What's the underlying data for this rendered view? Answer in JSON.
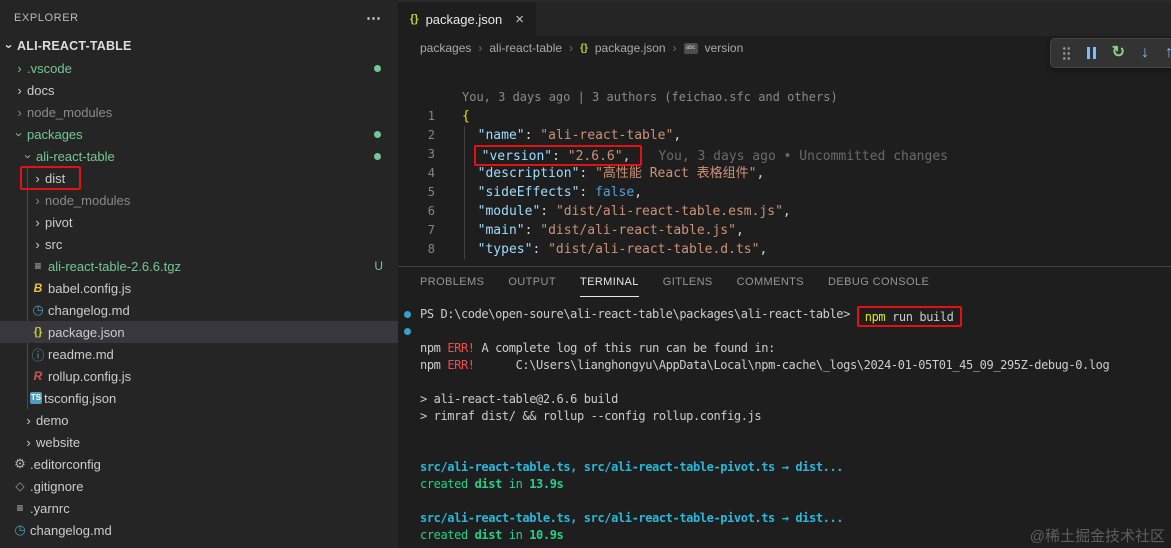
{
  "sidebar": {
    "header": "EXPLORER",
    "more_label": "⋯",
    "root": "ALI-REACT-TABLE",
    "items": [
      {
        "label": ".vscode",
        "kind": "folder",
        "indent": 1,
        "color": "green",
        "badge": "dot"
      },
      {
        "label": "docs",
        "kind": "folder",
        "indent": 1
      },
      {
        "label": "node_modules",
        "kind": "folder",
        "indent": 1,
        "color": "dim"
      },
      {
        "label": "packages",
        "kind": "folder",
        "indent": 1,
        "color": "green",
        "badge": "dot",
        "open": true
      },
      {
        "label": "ali-react-table",
        "kind": "folder",
        "indent": 2,
        "color": "green",
        "badge": "dot",
        "open": true
      },
      {
        "label": "dist",
        "kind": "folder",
        "indent": 3,
        "redbox": true
      },
      {
        "label": "node_modules",
        "kind": "folder",
        "indent": 3,
        "color": "dim"
      },
      {
        "label": "pivot",
        "kind": "folder",
        "indent": 3
      },
      {
        "label": "src",
        "kind": "folder",
        "indent": 3
      },
      {
        "label": "ali-react-table-2.6.6.tgz",
        "kind": "file",
        "icon": "lines",
        "indent": 3,
        "color": "green",
        "badge": "U"
      },
      {
        "label": "babel.config.js",
        "kind": "file",
        "icon": "babel",
        "indent": 3
      },
      {
        "label": "changelog.md",
        "kind": "file",
        "icon": "clock",
        "indent": 3
      },
      {
        "label": "package.json",
        "kind": "file",
        "icon": "braces",
        "indent": 3,
        "selected": true
      },
      {
        "label": "readme.md",
        "kind": "file",
        "icon": "info",
        "indent": 3
      },
      {
        "label": "rollup.config.js",
        "kind": "file",
        "icon": "rollup",
        "indent": 3
      },
      {
        "label": "tsconfig.json",
        "kind": "file",
        "icon": "ts",
        "indent": 3
      },
      {
        "label": "demo",
        "kind": "folder",
        "indent": 2
      },
      {
        "label": "website",
        "kind": "folder",
        "indent": 2
      },
      {
        "label": ".editorconfig",
        "kind": "file",
        "icon": "gear",
        "indent": 1
      },
      {
        "label": ".gitignore",
        "kind": "file",
        "icon": "git",
        "indent": 1
      },
      {
        "label": ".yarnrc",
        "kind": "file",
        "icon": "lines",
        "indent": 1
      },
      {
        "label": "changelog.md",
        "kind": "file",
        "icon": "clock",
        "indent": 1
      }
    ]
  },
  "editor": {
    "tab": "package.json",
    "breadcrumbs": [
      "packages",
      "ali-react-table",
      "package.json",
      "version"
    ],
    "codelens": "You, 3 days ago | 3 authors (feichao.sfc and others)",
    "lines": [
      {
        "num": "1",
        "seg": [
          {
            "t": "{",
            "c": "brace"
          }
        ]
      },
      {
        "num": "2",
        "seg": [
          {
            "t": "  "
          },
          {
            "t": "\"name\"",
            "c": "key"
          },
          {
            "t": ": "
          },
          {
            "t": "\"ali-react-table\"",
            "c": "str"
          },
          {
            "t": ","
          }
        ]
      },
      {
        "num": "3",
        "seg": [
          {
            "t": "  "
          },
          {
            "t": "\"version\"",
            "c": "key",
            "rb": true
          },
          {
            "t": ": ",
            "rb": true
          },
          {
            "t": "\"2.6.6\"",
            "c": "str",
            "rb": true
          },
          {
            "t": ",",
            "rb": true
          }
        ],
        "blame": "You, 3 days ago • Uncommitted changes"
      },
      {
        "num": "4",
        "seg": [
          {
            "t": "  "
          },
          {
            "t": "\"description\"",
            "c": "key"
          },
          {
            "t": ": "
          },
          {
            "t": "\"高性能 React 表格组件\"",
            "c": "str"
          },
          {
            "t": ","
          }
        ]
      },
      {
        "num": "5",
        "seg": [
          {
            "t": "  "
          },
          {
            "t": "\"sideEffects\"",
            "c": "key"
          },
          {
            "t": ": "
          },
          {
            "t": "false",
            "c": "kw"
          },
          {
            "t": ","
          }
        ]
      },
      {
        "num": "6",
        "seg": [
          {
            "t": "  "
          },
          {
            "t": "\"module\"",
            "c": "key"
          },
          {
            "t": ": "
          },
          {
            "t": "\"dist/ali-react-table.esm.js\"",
            "c": "str"
          },
          {
            "t": ","
          }
        ]
      },
      {
        "num": "7",
        "seg": [
          {
            "t": "  "
          },
          {
            "t": "\"main\"",
            "c": "key"
          },
          {
            "t": ": "
          },
          {
            "t": "\"dist/ali-react-table.js\"",
            "c": "str"
          },
          {
            "t": ","
          }
        ]
      },
      {
        "num": "8",
        "seg": [
          {
            "t": "  "
          },
          {
            "t": "\"types\"",
            "c": "key"
          },
          {
            "t": ": "
          },
          {
            "t": "\"dist/ali-react-table.d.ts\"",
            "c": "str"
          },
          {
            "t": ","
          }
        ]
      }
    ]
  },
  "panel": {
    "tabs": [
      "PROBLEMS",
      "OUTPUT",
      "TERMINAL",
      "GITLENS",
      "COMMENTS",
      "DEBUG CONSOLE"
    ],
    "active_tab": "TERMINAL",
    "lines": [
      {
        "dot": true,
        "seg": [
          {
            "t": "PS D:\\code\\open-soure\\ali-react-table\\packages\\ali-react-table> "
          },
          {
            "t": "npm",
            "c": "yel",
            "rb": true
          },
          {
            "t": " run build",
            "rb": true
          }
        ]
      },
      {
        "dot": true,
        "seg": []
      },
      {
        "seg": [
          {
            "t": "npm "
          },
          {
            "t": "ERR!",
            "c": "err"
          },
          {
            "t": " A complete log of this run can be found in:"
          }
        ]
      },
      {
        "seg": [
          {
            "t": "npm "
          },
          {
            "t": "ERR!",
            "c": "err"
          },
          {
            "t": "      C:\\Users\\lianghongyu\\AppData\\Local\\npm-cache\\_logs\\2024-01-05T01_45_09_295Z-debug-0.log"
          }
        ]
      },
      {
        "seg": []
      },
      {
        "seg": [
          {
            "t": "> ali-react-table@2.6.6 build"
          }
        ]
      },
      {
        "seg": [
          {
            "t": "> rimraf dist/ && rollup --config rollup.config.js"
          }
        ]
      },
      {
        "seg": []
      },
      {
        "seg": []
      },
      {
        "seg": [
          {
            "t": "src/ali-react-table.ts, src/ali-react-table-pivot.ts → dist...",
            "c": "cyan",
            "b": true
          }
        ]
      },
      {
        "seg": [
          {
            "t": "created ",
            "c": "grn"
          },
          {
            "t": "dist",
            "c": "grn",
            "b": true
          },
          {
            "t": " in ",
            "c": "grn"
          },
          {
            "t": "13.9s",
            "c": "grn",
            "b": true
          }
        ]
      },
      {
        "seg": []
      },
      {
        "seg": [
          {
            "t": "src/ali-react-table.ts, src/ali-react-table-pivot.ts → dist...",
            "c": "cyan",
            "b": true
          }
        ]
      },
      {
        "seg": [
          {
            "t": "created ",
            "c": "grn"
          },
          {
            "t": "dist",
            "c": "grn",
            "b": true
          },
          {
            "t": " in ",
            "c": "grn"
          },
          {
            "t": "10.9s",
            "c": "grn",
            "b": true
          }
        ]
      }
    ]
  },
  "watermark": "@稀土掘金技术社区"
}
